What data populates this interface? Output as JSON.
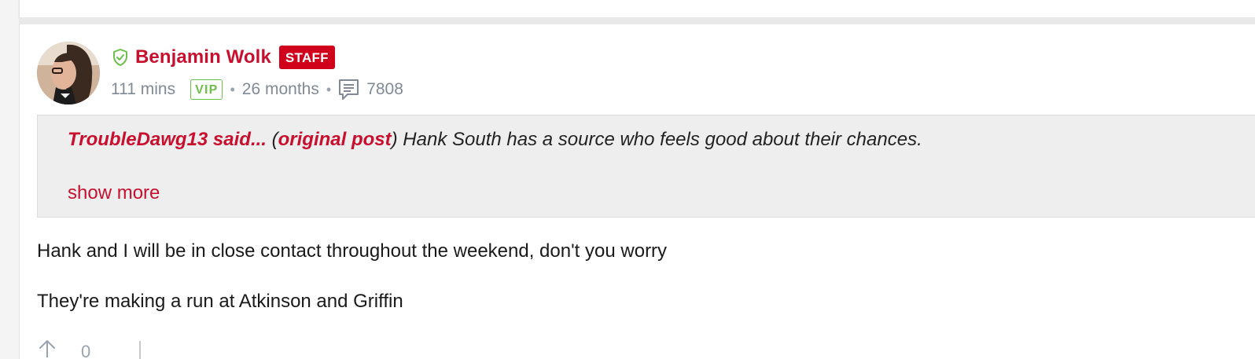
{
  "post": {
    "author": {
      "name": "Benjamin Wolk",
      "badge": "STAFF",
      "verified_icon": "shield-check-icon",
      "avatar": "avatar-photo"
    },
    "meta": {
      "time_ago": "111 mins",
      "membership": "VIP",
      "tenure": "26 months",
      "comment_icon": "comment-icon",
      "post_count": "7808",
      "separator": "•"
    },
    "quote": {
      "author": "TroubleDawg13 said...",
      "open_paren": " (",
      "link_label": "original post",
      "close_paren": ")",
      "text": " Hank South has a source who feels good about their chances.",
      "show_more": "show more"
    },
    "body": [
      "Hank and I will be in close contact throughout the weekend, don't you worry",
      "They're making a run at Atkinson and Griffin"
    ],
    "votes": {
      "upvote_icon": "arrow-up-icon",
      "count": "0"
    }
  },
  "colors": {
    "accent": "#c8102e",
    "staff_badge": "#d0021b",
    "vip": "#6cc04a",
    "meta_text": "#808a96",
    "quote_bg": "#eeeeee"
  }
}
